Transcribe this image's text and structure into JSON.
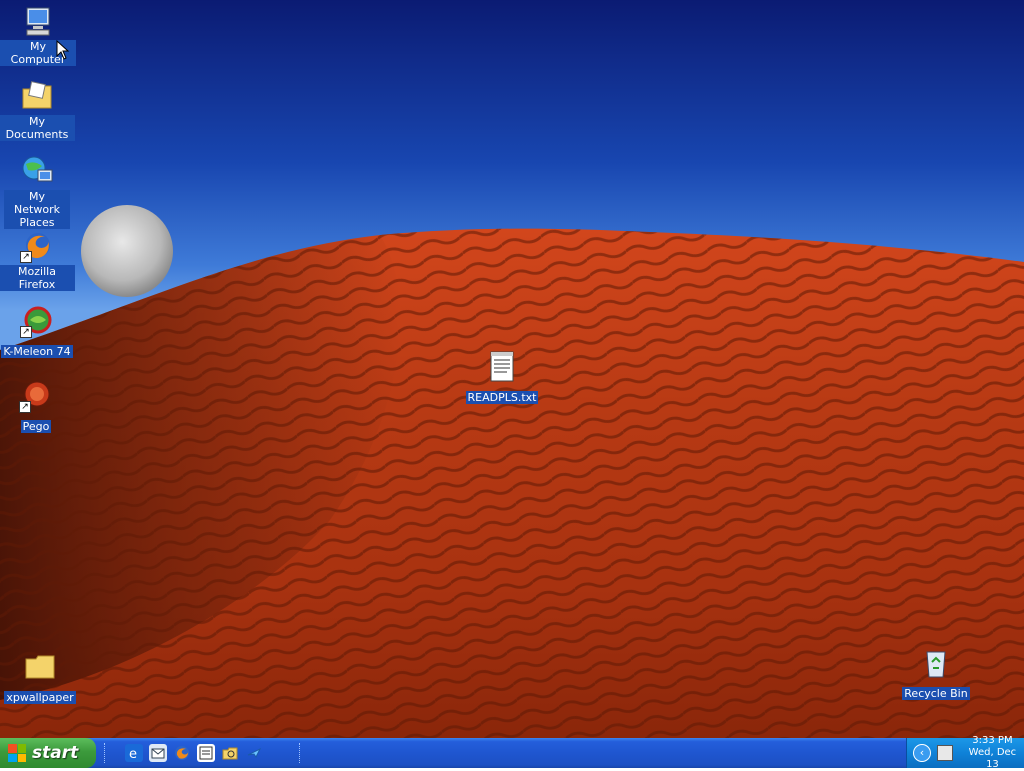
{
  "desktop_icons": [
    {
      "label": "My Computer",
      "icon": "computer-icon"
    },
    {
      "label": "My Documents",
      "icon": "documents-folder-icon"
    },
    {
      "label": "My Network Places",
      "icon": "network-places-icon"
    },
    {
      "label": "Mozilla Firefox",
      "icon": "firefox-icon"
    },
    {
      "label": "K-Meleon 74",
      "icon": "k-meleon-icon"
    },
    {
      "label": "Pego",
      "icon": "pego-icon"
    },
    {
      "label": "READPLS.txt",
      "icon": "text-file-icon"
    },
    {
      "label": "xpwallpaper",
      "icon": "folder-icon"
    },
    {
      "label": "Recycle Bin",
      "icon": "recycle-bin-icon"
    }
  ],
  "taskbar": {
    "start_label": "start",
    "quick_launch": [
      {
        "icon": "internet-explorer-icon"
      },
      {
        "icon": "outlook-express-icon"
      },
      {
        "icon": "firefox-icon"
      },
      {
        "icon": "notepad-icon"
      },
      {
        "icon": "explorer-icon"
      },
      {
        "icon": "messenger-icon"
      }
    ],
    "clock_time": "3:33 PM",
    "clock_date": "Wed, Dec 13"
  },
  "colors": {
    "taskbar_blue": "#245edb",
    "start_green": "#3c9a3c",
    "label_highlight": "#1b4fb0"
  }
}
